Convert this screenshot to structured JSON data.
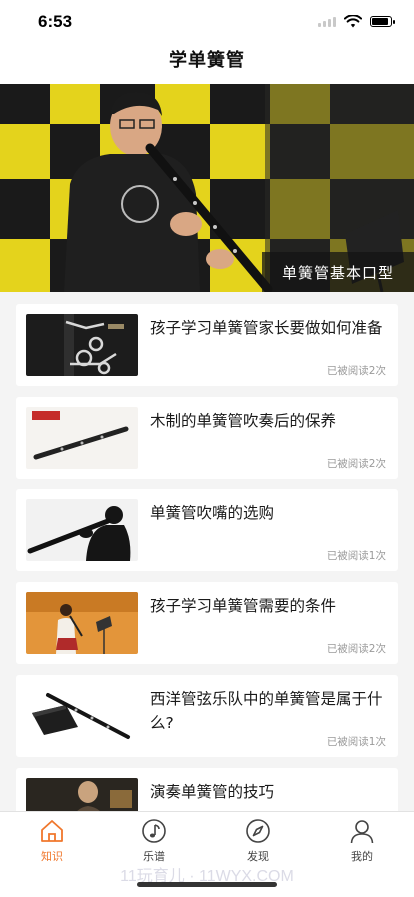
{
  "status": {
    "time": "6:53"
  },
  "header": {
    "title": "学单簧管"
  },
  "banner": {
    "caption": "单簧管基本口型"
  },
  "articles": [
    {
      "title": "孩子学习单簧管家长要做如何准备",
      "meta": "已被阅读2次",
      "thumb": "clarinet-keys-photo"
    },
    {
      "title": "木制的单簧管吹奏后的保养",
      "meta": "已被阅读2次",
      "thumb": "wooden-clarinet-photo"
    },
    {
      "title": "单簧管吹嘴的选购",
      "meta": "已被阅读1次",
      "thumb": "silhouette-player-photo"
    },
    {
      "title": "孩子学习单簧管需要的条件",
      "meta": "已被阅读2次",
      "thumb": "child-performer-photo"
    },
    {
      "title": "西洋管弦乐队中的单簧管是属于什么?",
      "meta": "已被阅读1次",
      "thumb": "clarinet-case-photo"
    },
    {
      "title": "演奏单簧管的技巧",
      "meta": "",
      "thumb": "musician-photo"
    }
  ],
  "tabs": [
    {
      "label": "知识",
      "icon": "home-icon",
      "active": true
    },
    {
      "label": "乐谱",
      "icon": "music-note-icon",
      "active": false
    },
    {
      "label": "发现",
      "icon": "compass-icon",
      "active": false
    },
    {
      "label": "我的",
      "icon": "user-icon",
      "active": false
    }
  ],
  "watermark": "11玩育儿 · 11WYX.COM",
  "colors": {
    "accent": "#f0772c",
    "background": "#f4f4f4"
  }
}
